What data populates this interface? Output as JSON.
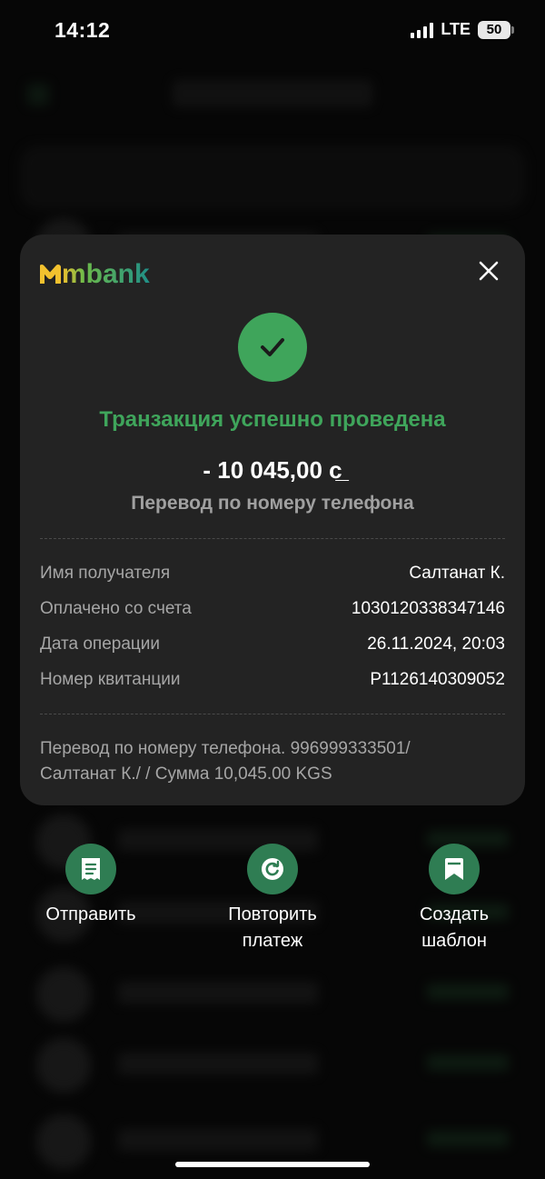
{
  "status_bar": {
    "time": "14:12",
    "network": "LTE",
    "battery": "50"
  },
  "receipt": {
    "brand": "mbank",
    "status": "Транзакция успешно проведена",
    "amount": "- 10 045,00 с̲",
    "type": "Перевод по номеру телефона",
    "details": [
      {
        "label": "Имя получателя",
        "value": "Салтанат К."
      },
      {
        "label": "Оплачено со счета",
        "value": "1030120338347146"
      },
      {
        "label": "Дата операции",
        "value": "26.11.2024, 20:03"
      },
      {
        "label": "Номер квитанции",
        "value": "P1126140309052"
      }
    ],
    "note_line1": "Перевод по номеру телефона. 996999333501/",
    "note_line2": "Салтанат К./  / Сумма 10,045.00 KGS"
  },
  "actions": [
    {
      "label": "Отправить",
      "icon": "receipt-icon"
    },
    {
      "label": "Повторить платеж",
      "icon": "repeat-icon"
    },
    {
      "label": "Создать шаблон",
      "icon": "bookmark-icon"
    }
  ],
  "colors": {
    "success": "#3fa55b",
    "action": "#2f7d53",
    "card": "#232323"
  }
}
